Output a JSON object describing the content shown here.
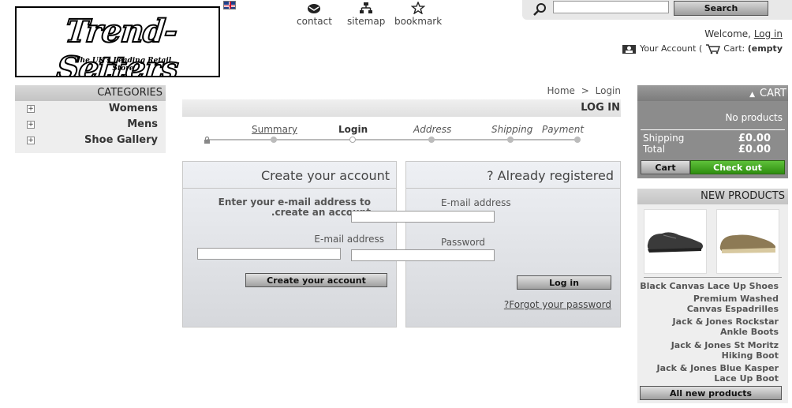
{
  "logo": {
    "title": "Trend-Setters",
    "tagline": "The UK's Leading Retail Store"
  },
  "top_links": {
    "contact": "contact",
    "sitemap": "sitemap",
    "bookmark": "bookmark"
  },
  "search": {
    "value": "",
    "button": "Search"
  },
  "header": {
    "welcome": "Welcome,",
    "login_link": "Log in",
    "account": "Your Account",
    "paren": "(",
    "cart": "Cart:",
    "cart_status": "(empty"
  },
  "categories": {
    "title": "CATEGORIES",
    "items": [
      "Womens",
      "Mens",
      "Shoe Gallery"
    ]
  },
  "breadcrumb": {
    "home": "Home",
    "sep": ">",
    "current": "Login"
  },
  "page": {
    "heading": "LOG IN"
  },
  "steps": [
    "Summary",
    "Login",
    "Address",
    "Shipping",
    "Payment"
  ],
  "create_account": {
    "title": "Create your account",
    "instructions_line1": "Enter your e-mail address to",
    "instructions_line2": ".create an account",
    "email_label": "E-mail address",
    "email_value": "",
    "button": "Create your account"
  },
  "registered": {
    "title": "? Already registered",
    "email_label": "E-mail address",
    "email_value": "",
    "password_label": "Password",
    "password_value": "",
    "button": "Log in",
    "forgot": "?Forgot your password"
  },
  "cart": {
    "title": "CART",
    "empty_text": "No products",
    "shipping_label": "Shipping",
    "shipping_value": "£0.00",
    "total_label": "Total",
    "total_value": "£0.00",
    "cart_button": "Cart",
    "checkout_button": "Check out"
  },
  "new_products": {
    "title": "NEW PRODUCTS",
    "items": [
      "Black Canvas Lace Up Shoes",
      "Premium Washed Canvas Espadrilles",
      "Jack & Jones Rockstar Ankle Boots",
      "Jack & Jones St Moritz Hiking Boot",
      "Jack & Jones Blue Kasper Lace Up Boot"
    ],
    "all_button": "All new products"
  },
  "colors": {
    "checkout_green": "#3a9e1a",
    "panel_gray": "#d6d8dc",
    "cart_gray": "#8c8c8c"
  }
}
